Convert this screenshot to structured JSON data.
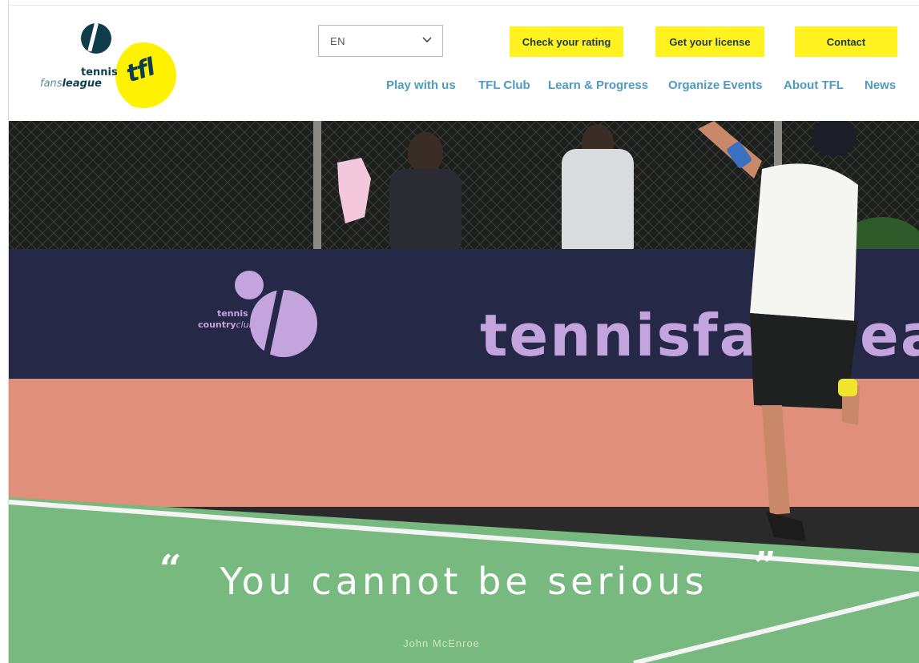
{
  "brand": {
    "logo_word_top": "tennis",
    "logo_word_bottom_light": "fans",
    "logo_word_bottom_bold": "league",
    "logo_badge": "tfl",
    "colors": {
      "navy": "#0f3d4c",
      "yellow": "#fff200",
      "nav_blue": "#4e9bc1"
    }
  },
  "language": {
    "selected": "EN"
  },
  "cta": {
    "rating": "Check your rating",
    "license": "Get your license",
    "contact": "Contact"
  },
  "nav": {
    "play": "Play with us",
    "club": "TFL Club",
    "learn": "Learn & Progress",
    "events": "Organize Events",
    "about": "About TFL",
    "news": "News"
  },
  "hero": {
    "quote": "You cannot be serious",
    "author": "John McEnroe",
    "banner_text": "tennisfansleague",
    "sponsor_top": "tennis",
    "sponsor_bottom_bold": "country",
    "sponsor_bottom_light": "club"
  }
}
